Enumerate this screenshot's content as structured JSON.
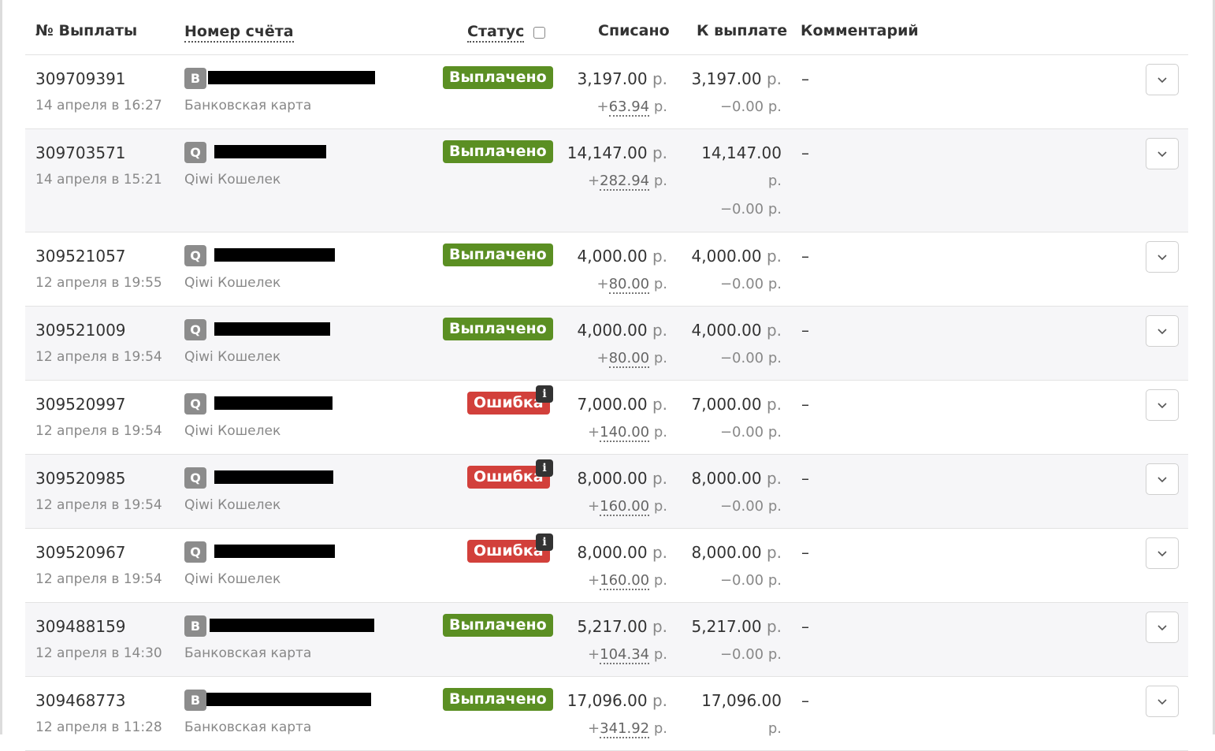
{
  "header": {
    "col_id": "№ Выплаты",
    "col_account": "Номер счёта",
    "col_status": "Статус",
    "col_charged": "Списано",
    "col_payout": "К выплате",
    "col_comment": "Комментарий"
  },
  "colors": {
    "ok": "#5b8f23",
    "error": "#d2403b",
    "type_badge": "#8c8c8c"
  },
  "rows": [
    {
      "id": "309709391",
      "date": "14 апреля в 16:27",
      "type_letter": "B",
      "type_label": "Банковская карта",
      "status": "Выплачено",
      "status_kind": "ok",
      "charged": "3,197.00",
      "charged_unit": "р.",
      "fee_sign": "+",
      "fee": "63.94",
      "fee_unit": "р.",
      "payout": "3,197.00",
      "payout_unit": "р.",
      "deduct": "−0.00",
      "deduct_unit": "р.",
      "comment": "–"
    },
    {
      "id": "309703571",
      "date": "14 апреля в 15:21",
      "type_letter": "Q",
      "type_label": "Qiwi Кошелек",
      "status": "Выплачено",
      "status_kind": "ok",
      "charged": "14,147.00",
      "charged_unit": "р.",
      "fee_sign": "+",
      "fee": "282.94",
      "fee_unit": "р.",
      "payout": "14,147.00",
      "payout_unit": "р.",
      "deduct": "−0.00",
      "deduct_unit": "р.",
      "comment": "–"
    },
    {
      "id": "309521057",
      "date": "12 апреля в 19:55",
      "type_letter": "Q",
      "type_label": "Qiwi Кошелек",
      "status": "Выплачено",
      "status_kind": "ok",
      "charged": "4,000.00",
      "charged_unit": "р.",
      "fee_sign": "+",
      "fee": "80.00",
      "fee_unit": "р.",
      "payout": "4,000.00",
      "payout_unit": "р.",
      "deduct": "−0.00",
      "deduct_unit": "р.",
      "comment": "–"
    },
    {
      "id": "309521009",
      "date": "12 апреля в 19:54",
      "type_letter": "Q",
      "type_label": "Qiwi Кошелек",
      "status": "Выплачено",
      "status_kind": "ok",
      "charged": "4,000.00",
      "charged_unit": "р.",
      "fee_sign": "+",
      "fee": "80.00",
      "fee_unit": "р.",
      "payout": "4,000.00",
      "payout_unit": "р.",
      "deduct": "−0.00",
      "deduct_unit": "р.",
      "comment": "–"
    },
    {
      "id": "309520997",
      "date": "12 апреля в 19:54",
      "type_letter": "Q",
      "type_label": "Qiwi Кошелек",
      "status": "Ошибка",
      "status_kind": "error",
      "charged": "7,000.00",
      "charged_unit": "р.",
      "fee_sign": "+",
      "fee": "140.00",
      "fee_unit": "р.",
      "payout": "7,000.00",
      "payout_unit": "р.",
      "deduct": "−0.00",
      "deduct_unit": "р.",
      "comment": "–"
    },
    {
      "id": "309520985",
      "date": "12 апреля в 19:54",
      "type_letter": "Q",
      "type_label": "Qiwi Кошелек",
      "status": "Ошибка",
      "status_kind": "error",
      "charged": "8,000.00",
      "charged_unit": "р.",
      "fee_sign": "+",
      "fee": "160.00",
      "fee_unit": "р.",
      "payout": "8,000.00",
      "payout_unit": "р.",
      "deduct": "−0.00",
      "deduct_unit": "р.",
      "comment": "–"
    },
    {
      "id": "309520967",
      "date": "12 апреля в 19:54",
      "type_letter": "Q",
      "type_label": "Qiwi Кошелек",
      "status": "Ошибка",
      "status_kind": "error",
      "charged": "8,000.00",
      "charged_unit": "р.",
      "fee_sign": "+",
      "fee": "160.00",
      "fee_unit": "р.",
      "payout": "8,000.00",
      "payout_unit": "р.",
      "deduct": "−0.00",
      "deduct_unit": "р.",
      "comment": "–"
    },
    {
      "id": "309488159",
      "date": "12 апреля в 14:30",
      "type_letter": "B",
      "type_label": "Банковская карта",
      "status": "Выплачено",
      "status_kind": "ok",
      "charged": "5,217.00",
      "charged_unit": "р.",
      "fee_sign": "+",
      "fee": "104.34",
      "fee_unit": "р.",
      "payout": "5,217.00",
      "payout_unit": "р.",
      "deduct": "−0.00",
      "deduct_unit": "р.",
      "comment": "–"
    },
    {
      "id": "309468773",
      "date": "12 апреля в 11:28",
      "type_letter": "B",
      "type_label": "Банковская карта",
      "status": "Выплачено",
      "status_kind": "ok",
      "charged": "17,096.00",
      "charged_unit": "р.",
      "fee_sign": "+",
      "fee": "341.92",
      "fee_unit": "р.",
      "payout": "17,096.00",
      "payout_unit": "р.",
      "comment": "–"
    }
  ]
}
